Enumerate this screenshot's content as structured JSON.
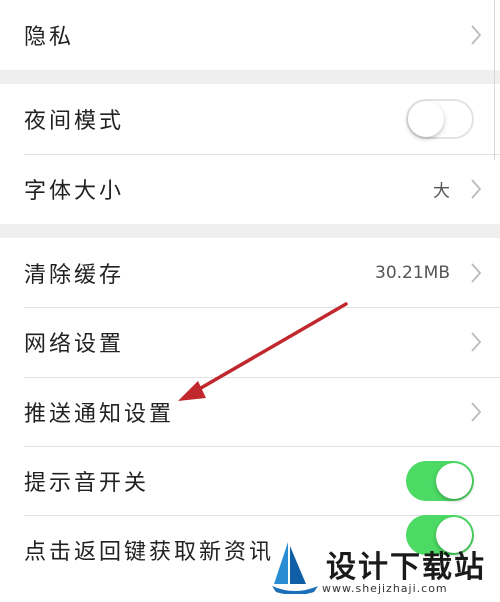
{
  "settings": {
    "privacy": {
      "label": "隐私"
    },
    "night_mode": {
      "label": "夜间模式",
      "enabled": false
    },
    "font_size": {
      "label": "字体大小",
      "value": "大"
    },
    "clear_cache": {
      "label": "清除缓存",
      "value": "30.21MB"
    },
    "network": {
      "label": "网络设置"
    },
    "push": {
      "label": "推送通知设置"
    },
    "sound": {
      "label": "提示音开关",
      "enabled": true
    },
    "back_refresh": {
      "label": "点击返回键获取新资讯",
      "enabled": true
    }
  },
  "annotation": {
    "arrow_color": "#c0282d",
    "arrow_target": "推送通知设置"
  },
  "watermark": {
    "title": "设计下载站",
    "url": "www.shejizhaji.com"
  },
  "colors": {
    "toggle_on": "#4cd964",
    "background": "#efefef"
  }
}
